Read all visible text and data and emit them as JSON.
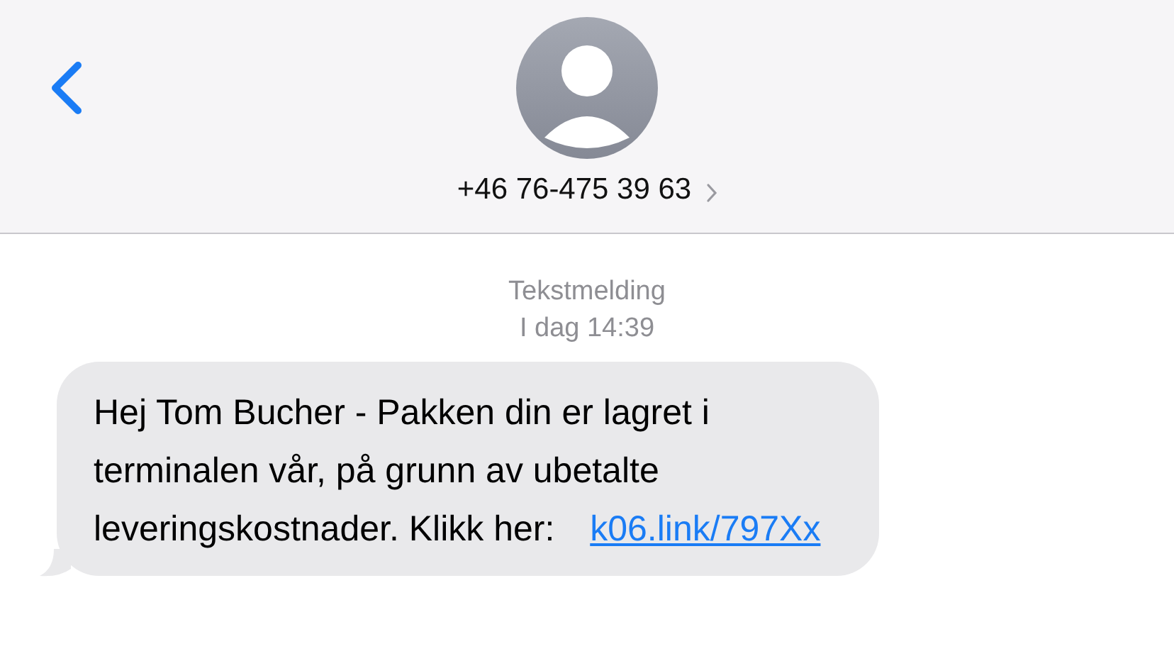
{
  "header": {
    "contact": "+46 76-475 39 63"
  },
  "conversation_info": {
    "service": "Tekstmelding",
    "timestamp": "I dag 14:39"
  },
  "messages": [
    {
      "kind": "incoming",
      "text": "Hej Tom Bucher - Pakken din er lagret i terminalen vår, på grunn av ubetalte leveringskostnader. Klikk her:",
      "link": "k06.link/797Xx"
    }
  ]
}
